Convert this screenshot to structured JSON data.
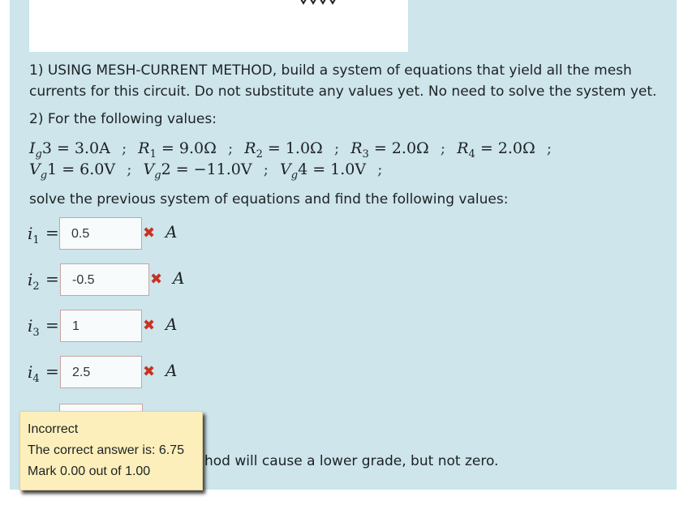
{
  "question": {
    "part1": "1) USING MESH-CURRENT METHOD, build a system of equations that yield all the mesh currents for this circuit. Do not substitute any values yet. No need to solve the system yet.",
    "part2_heading": "2) For the following values:",
    "values_line1": [
      {
        "sym": "I",
        "sub": "g",
        "tail": "3 = 3.0A"
      },
      {
        "sym": "R",
        "sub": "1",
        "tail": " = 9.0Ω"
      },
      {
        "sym": "R",
        "sub": "2",
        "tail": " = 1.0Ω"
      },
      {
        "sym": "R",
        "sub": "3",
        "tail": " = 2.0Ω"
      },
      {
        "sym": "R",
        "sub": "4",
        "tail": " = 2.0Ω"
      }
    ],
    "values_line2": [
      {
        "sym": "V",
        "sub": "g",
        "tail": "1 = 6.0V"
      },
      {
        "sym": "V",
        "sub": "g",
        "tail": "2 = −11.0V"
      },
      {
        "sym": "V",
        "sub": "g",
        "tail": "4 = 1.0V"
      }
    ],
    "separator": ";",
    "solve_prompt": "solve the previous system of equations and find the following values:"
  },
  "answers": [
    {
      "var": "i",
      "sub": "1",
      "value": "0.5",
      "unit": "A",
      "mark": "✖"
    },
    {
      "var": "i",
      "sub": "2",
      "value": "-0.5",
      "unit": "A",
      "mark": "✖"
    },
    {
      "var": "i",
      "sub": "3",
      "value": "1",
      "unit": "A",
      "mark": "✖"
    },
    {
      "var": "i",
      "sub": "4",
      "value": "2.5",
      "unit": "A",
      "mark": "✖"
    }
  ],
  "note_text": "hod will cause a lower grade, but not zero.",
  "feedback": {
    "status": "Incorrect",
    "correct_answer": "The correct answer is: 6.75",
    "mark": "Mark 0.00 out of 1.00"
  }
}
